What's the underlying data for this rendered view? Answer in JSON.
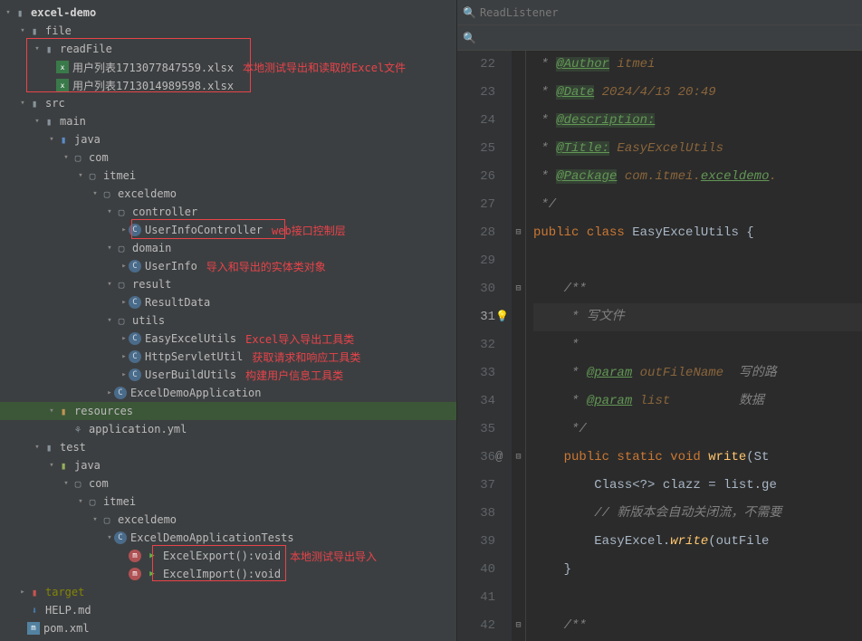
{
  "project_tree": {
    "root": "excel-demo",
    "file": "file",
    "readFile": "readFile",
    "xlsx1": "用户列表1713077847559.xlsx",
    "xlsx2": "用户列表1713014989598.xlsx",
    "src": "src",
    "main": "main",
    "java": "java",
    "com": "com",
    "itmei": "itmei",
    "exceldemo": "exceldemo",
    "controller": "controller",
    "UserInfoController": "UserInfoController",
    "domain": "domain",
    "UserInfo": "UserInfo",
    "result": "result",
    "ResultData": "ResultData",
    "utils": "utils",
    "EasyExcelUtils": "EasyExcelUtils",
    "HttpServletUtil": "HttpServletUtil",
    "UserBuildUtils": "UserBuildUtils",
    "ExcelDemoApplication": "ExcelDemoApplication",
    "resources": "resources",
    "appyml": "application.yml",
    "test": "test",
    "ExcelDemoApplicationTests": "ExcelDemoApplicationTests",
    "ExcelExport": "ExcelExport():void",
    "ExcelImport": "ExcelImport():void",
    "target": "target",
    "help": "HELP.md",
    "pom": "pom.xml"
  },
  "annotations": {
    "a1": "本地测试导出和读取的Excel文件",
    "a2": "web接口控制层",
    "a3": "导入和导出的实体类对象",
    "a4": "Excel导入导出工具类",
    "a5": "获取请求和响应工具类",
    "a6": "构建用户信息工具类",
    "a7": "本地测试导出导入"
  },
  "search": {
    "top": "ReadListener",
    "second": ""
  },
  "editor": {
    "lines": {
      "22": {
        "pre": " * ",
        "tag": "@Author",
        "txt": " itmei"
      },
      "23": {
        "pre": " * ",
        "tag": "@Date",
        "txt": " 2024/4/13 20:49"
      },
      "24": {
        "pre": " * ",
        "tag": "@description:",
        "txt": ""
      },
      "25": {
        "pre": " * ",
        "tag": "@Title:",
        "txt": " EasyExcelUtils"
      },
      "26": {
        "pre": " * ",
        "tag": "@Package",
        "txt": " com.itmei.",
        "u": "exceldemo"
      },
      "27": " */",
      "28": {
        "kw1": "public ",
        "kw2": "class ",
        "id": "EasyExcelUtils ",
        "b": "{"
      },
      "29": "",
      "30": "    /**",
      "31": "     * 写文件",
      "32": "     *",
      "33": {
        "pre": "     * ",
        "tag": "@param",
        "p": " outFileName",
        "desc": "  写的路"
      },
      "34": {
        "pre": "     * ",
        "tag": "@param",
        "p": " list",
        "desc": "         数据"
      },
      "35": "     */",
      "36": {
        "kw": "    public static void ",
        "m": "write",
        "r": "(St"
      },
      "37": "        Class<?> clazz = list.ge",
      "38_a": "        // ",
      "38_b": "新版本会自动关闭流，不需要",
      "39_a": "        EasyExcel.",
      "39_m": "write",
      "39_b": "(outFile",
      "40": "    }",
      "41": "",
      "42": "    /**"
    }
  }
}
